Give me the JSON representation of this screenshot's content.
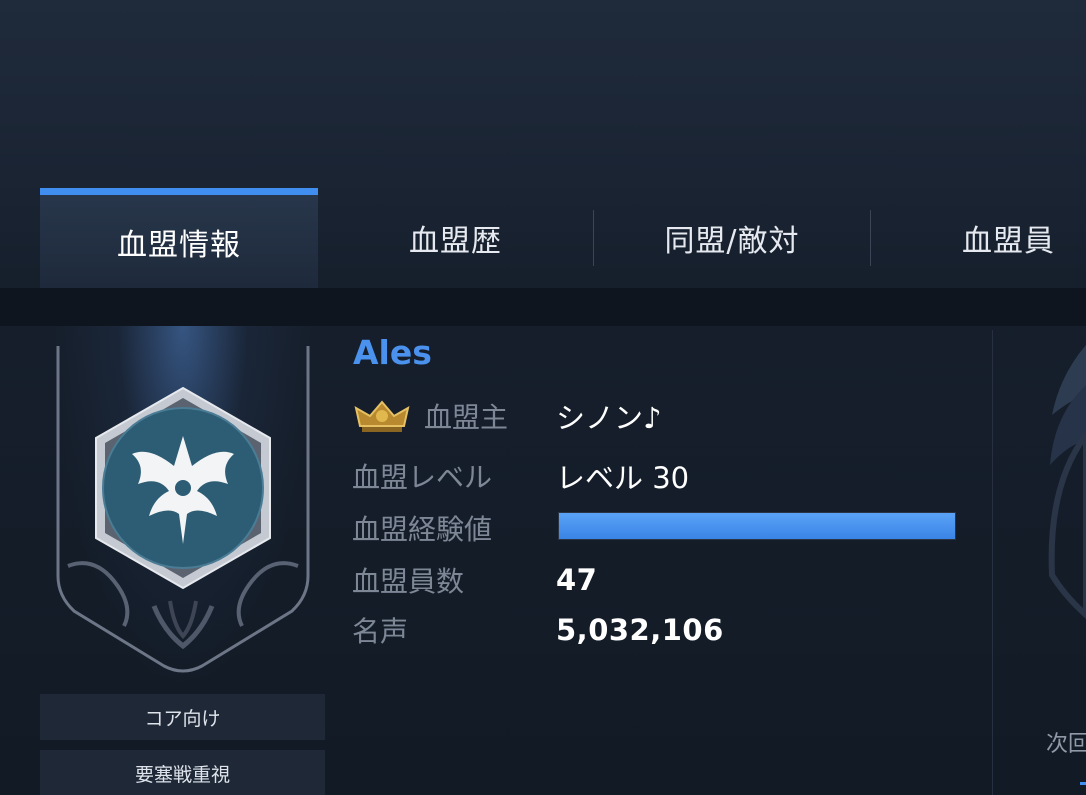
{
  "tabs": [
    {
      "label": "血盟情報",
      "active": true
    },
    {
      "label": "血盟歴",
      "active": false
    },
    {
      "label": "同盟/敵対",
      "active": false
    },
    {
      "label": "血盟員",
      "active": false
    }
  ],
  "guild": {
    "name": "Ales",
    "leader_label": "血盟主",
    "leader": "シノン♪",
    "level_label": "血盟レベル",
    "level": "レベル 30",
    "exp_label": "血盟経験値",
    "exp_fraction": 1.0,
    "members_label": "血盟員数",
    "members": "47",
    "fame_label": "名声",
    "fame": "5,032,106"
  },
  "tags": [
    "コア向け",
    "要塞戦重視"
  ],
  "side_panel": {
    "text": "次回"
  },
  "colors": {
    "accent": "#3f8ef0",
    "guild_name": "#4a92ee",
    "label": "#7d8796",
    "value": "#ffffff"
  },
  "icons": {
    "leader": "crown-icon",
    "emblem": "guild-emblem-wings-icon"
  }
}
